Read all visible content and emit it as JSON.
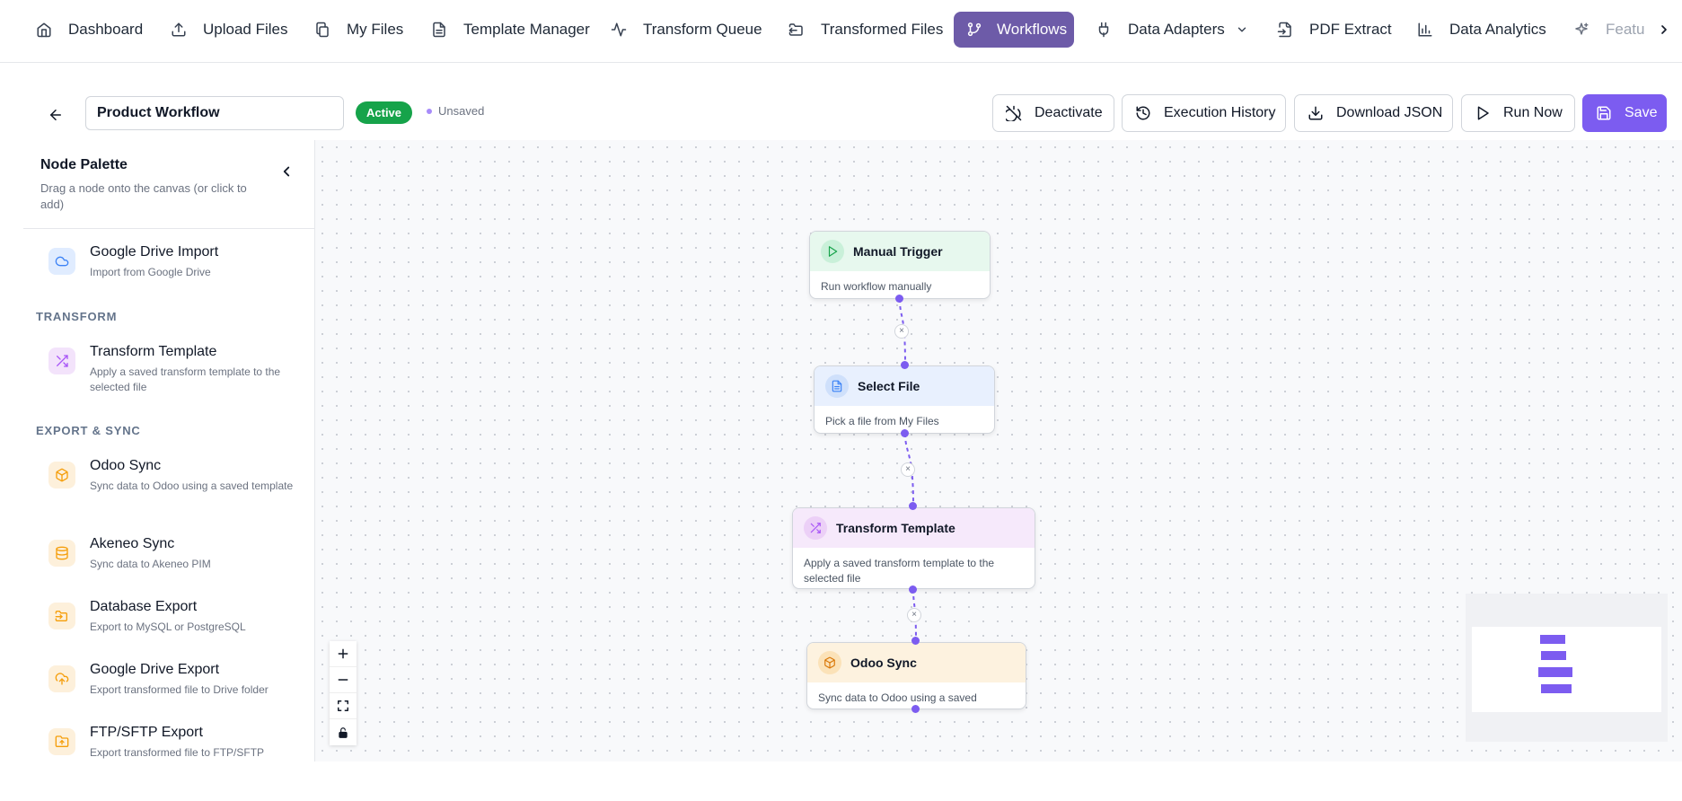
{
  "nav": {
    "items": [
      {
        "label": "Dashboard",
        "icon": "home-icon"
      },
      {
        "label": "Upload Files",
        "icon": "upload-icon"
      },
      {
        "label": "My Files",
        "icon": "files-icon"
      },
      {
        "label": "Template Manager",
        "icon": "document-icon"
      },
      {
        "label": "Transform Queue",
        "icon": "activity-icon"
      },
      {
        "label": "Transformed Files",
        "icon": "folder-output-icon"
      },
      {
        "label": "Workflows",
        "icon": "git-branch-icon",
        "active": true
      },
      {
        "label": "Data Adapters",
        "icon": "plug-icon"
      },
      {
        "label": "PDF Extract",
        "icon": "file-import-icon"
      },
      {
        "label": "Data Analytics",
        "icon": "bar-chart-icon"
      },
      {
        "label": "Featu",
        "icon": "sparkles-icon"
      }
    ]
  },
  "toolbar": {
    "workflow_name": "Product Workflow",
    "status_badge": "Active",
    "unsaved_label": "Unsaved",
    "deactivate_label": "Deactivate",
    "history_label": "Execution History",
    "download_label": "Download JSON",
    "run_label": "Run Now",
    "save_label": "Save"
  },
  "palette": {
    "title": "Node Palette",
    "subtitle": "Drag a node onto the canvas (or click to add)",
    "sections": [
      {
        "label": "TRANSFORM"
      },
      {
        "label": "EXPORT & SYNC"
      }
    ],
    "nodes": [
      {
        "name": "Google Drive Import",
        "desc": "Import from Google Drive",
        "icon": "cloud-icon"
      },
      {
        "name": "Transform Template",
        "desc": "Apply a saved transform template to the selected file",
        "icon": "shuffle-icon"
      },
      {
        "name": "Odoo Sync",
        "desc": "Sync data to Odoo using a saved template",
        "icon": "package-icon"
      },
      {
        "name": "Akeneo Sync",
        "desc": "Sync data to Akeneo PIM",
        "icon": "database-icon"
      },
      {
        "name": "Database Export",
        "desc": "Export to MySQL or PostgreSQL",
        "icon": "folder-output-icon"
      },
      {
        "name": "Google Drive Export",
        "desc": "Export transformed file to Drive folder",
        "icon": "cloud-upload-icon"
      },
      {
        "name": "FTP/SFTP Export",
        "desc": "Export transformed file to FTP/SFTP",
        "icon": "folder-plus-icon"
      }
    ]
  },
  "workflow": {
    "nodes": [
      {
        "title": "Manual Trigger",
        "desc": "Run workflow manually",
        "icon": "play-icon",
        "color": "#16a34a"
      },
      {
        "title": "Select File",
        "desc": "Pick a file from My Files",
        "icon": "file-text-icon",
        "color": "#3b82f6"
      },
      {
        "title": "Transform Template",
        "desc": "Apply a saved transform template to the selected file",
        "icon": "shuffle-icon",
        "color": "#a855f7"
      },
      {
        "title": "Odoo Sync",
        "desc": "Sync data to Odoo using a saved template",
        "icon": "package-icon",
        "color": "#d97706"
      }
    ],
    "edge_delete_symbol": "×"
  },
  "colors": {
    "accent": "#7c5cf0",
    "nav_active": "#6d5ba8",
    "active_badge": "#16a34a"
  }
}
